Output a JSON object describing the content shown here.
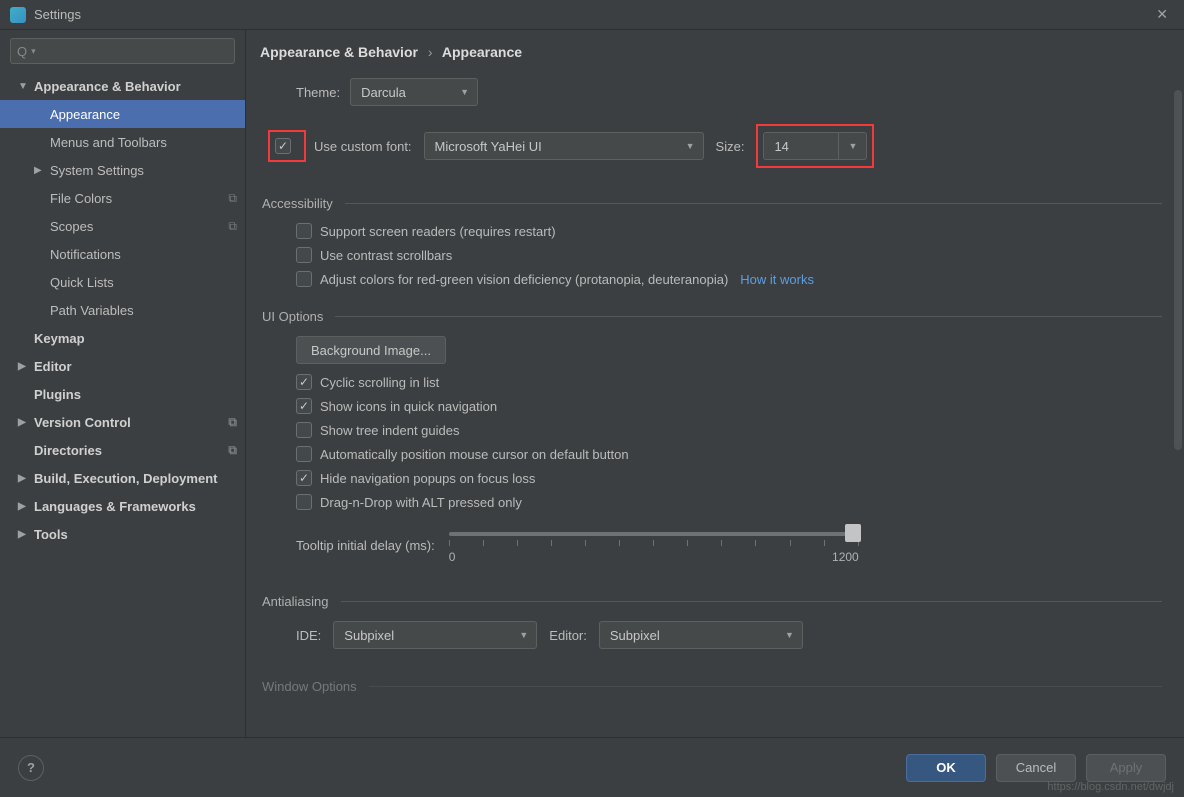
{
  "titlebar": {
    "title": "Settings"
  },
  "search": {
    "placeholder": ""
  },
  "sidebar": {
    "items": [
      {
        "label": "Appearance & Behavior",
        "expandable": true,
        "expanded": true,
        "level": 0
      },
      {
        "label": "Appearance",
        "level": 1,
        "selected": true
      },
      {
        "label": "Menus and Toolbars",
        "level": 1
      },
      {
        "label": "System Settings",
        "expandable": true,
        "expanded": false,
        "level": 1
      },
      {
        "label": "File Colors",
        "level": 1,
        "copy": true
      },
      {
        "label": "Scopes",
        "level": 1,
        "copy": true
      },
      {
        "label": "Notifications",
        "level": 1
      },
      {
        "label": "Quick Lists",
        "level": 1
      },
      {
        "label": "Path Variables",
        "level": 1
      },
      {
        "label": "Keymap",
        "level": 0
      },
      {
        "label": "Editor",
        "expandable": true,
        "expanded": false,
        "level": 0
      },
      {
        "label": "Plugins",
        "level": 0
      },
      {
        "label": "Version Control",
        "expandable": true,
        "expanded": false,
        "level": 0,
        "copy": true
      },
      {
        "label": "Directories",
        "level": 0,
        "copy": true
      },
      {
        "label": "Build, Execution, Deployment",
        "expandable": true,
        "expanded": false,
        "level": 0
      },
      {
        "label": "Languages & Frameworks",
        "expandable": true,
        "expanded": false,
        "level": 0
      },
      {
        "label": "Tools",
        "expandable": true,
        "expanded": false,
        "level": 0
      }
    ]
  },
  "breadcrumb": {
    "root": "Appearance & Behavior",
    "leaf": "Appearance"
  },
  "theme": {
    "label": "Theme:",
    "value": "Darcula"
  },
  "font": {
    "check_label": "Use custom font:",
    "value": "Microsoft YaHei UI",
    "size_label": "Size:",
    "size_value": "14"
  },
  "accessibility": {
    "title": "Accessibility",
    "screen_readers": "Support screen readers (requires restart)",
    "contrast_scrollbars": "Use contrast scrollbars",
    "color_deficiency": "Adjust colors for red-green vision deficiency (protanopia, deuteranopia)",
    "how_it_works": "How it works"
  },
  "ui_options": {
    "title": "UI Options",
    "background_button": "Background Image...",
    "cyclic_scrolling": "Cyclic scrolling in list",
    "show_icons": "Show icons in quick navigation",
    "tree_indent": "Show tree indent guides",
    "auto_mouse": "Automatically position mouse cursor on default button",
    "hide_nav": "Hide navigation popups on focus loss",
    "drag_alt": "Drag-n-Drop with ALT pressed only",
    "tooltip_label": "Tooltip initial delay (ms):",
    "slider_min": "0",
    "slider_max": "1200"
  },
  "antialiasing": {
    "title": "Antialiasing",
    "ide_label": "IDE:",
    "ide_value": "Subpixel",
    "editor_label": "Editor:",
    "editor_value": "Subpixel"
  },
  "window_options": {
    "title": "Window Options"
  },
  "buttons": {
    "ok": "OK",
    "cancel": "Cancel",
    "apply": "Apply",
    "help": "?"
  },
  "watermark": "https://blog.csdn.net/dwjdj"
}
